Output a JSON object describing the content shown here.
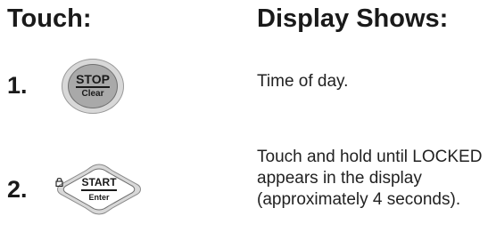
{
  "headings": {
    "touch": "Touch:",
    "display": "Display Shows:"
  },
  "steps": [
    {
      "number": "1.",
      "button": {
        "main_label": "STOP",
        "sub_label": "Clear",
        "icon": "stop-clear-button"
      },
      "description": "Time of day."
    },
    {
      "number": "2.",
      "button": {
        "main_label": "START",
        "sub_label": "Enter",
        "icon": "lock-icon"
      },
      "description": "Touch and hold until LOCKED appears in the display (approximately 4 seconds)."
    }
  ]
}
